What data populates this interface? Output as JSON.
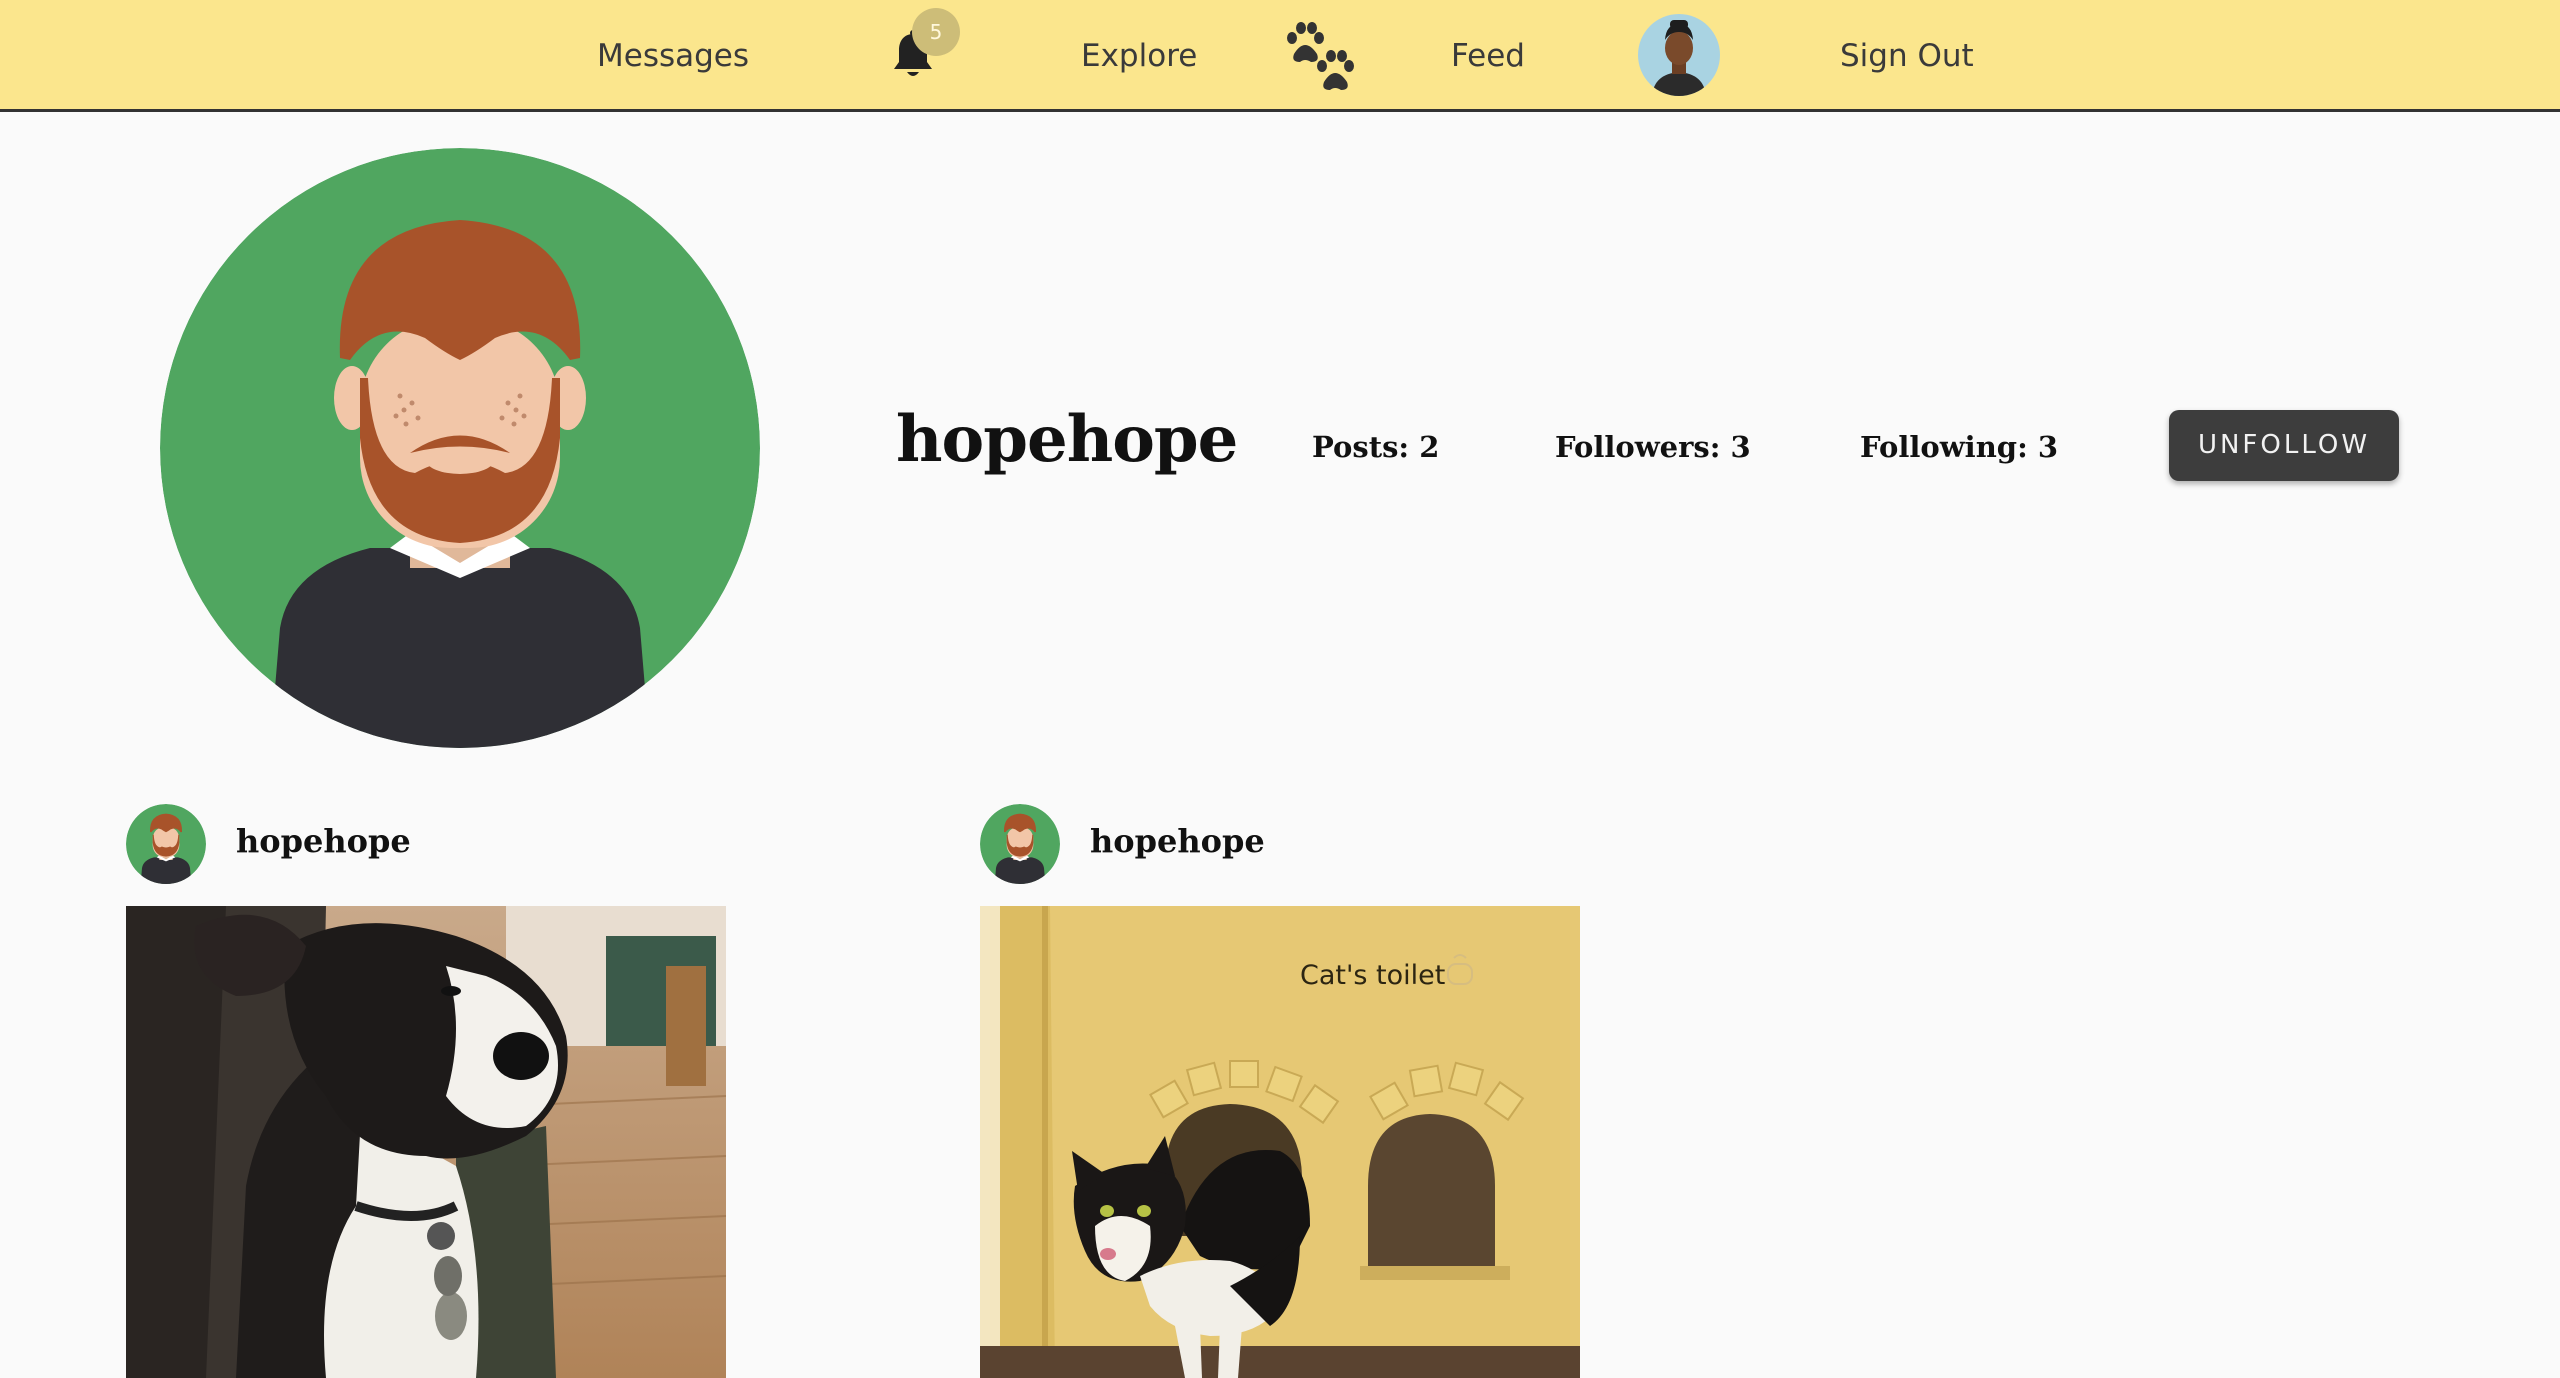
{
  "nav": {
    "messages": "Messages",
    "notification_count": "5",
    "explore": "Explore",
    "feed": "Feed",
    "sign_out": "Sign Out",
    "icons": [
      "bell-icon",
      "paw-icon",
      "avatar"
    ]
  },
  "profile": {
    "username": "hopehope",
    "posts": "Posts: 2",
    "followers": "Followers: 3",
    "following": "Following: 3",
    "unfollow_label": "UNFOLLOW"
  },
  "posts": [
    {
      "user": "hopehope",
      "image": "dog-photo"
    },
    {
      "user": "hopehope",
      "image": "cat-photo",
      "sign_text": "Cat's toilet"
    }
  ],
  "colors": {
    "nav_bg": "#fbe68d",
    "avatar_green": "#50a660",
    "hair": "#a8532a",
    "button_bg": "#3d3d3d",
    "page_bg": "#fafafa"
  }
}
